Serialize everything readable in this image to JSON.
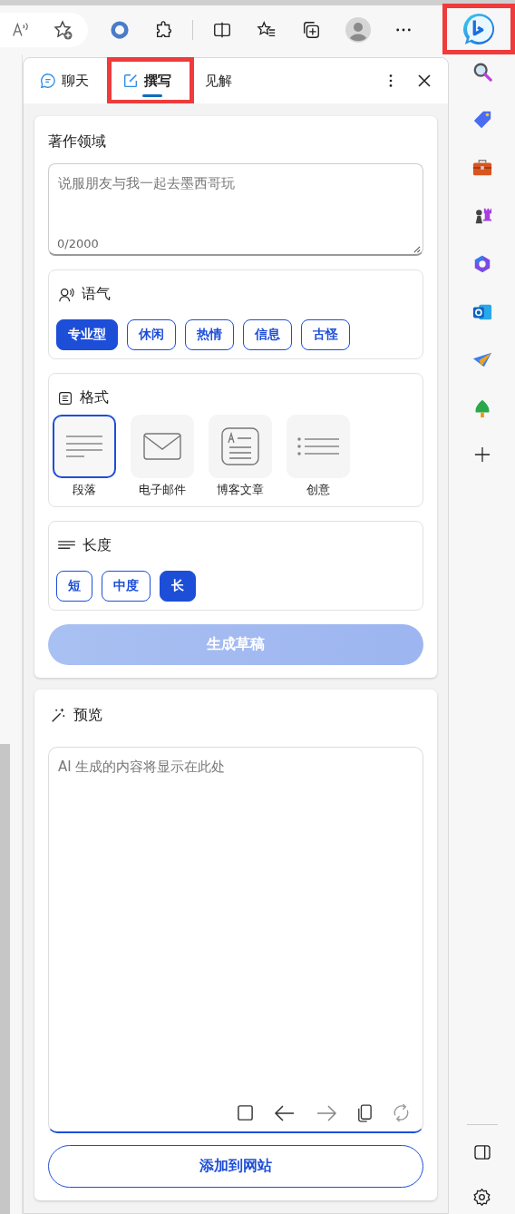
{
  "bing_button": {
    "highlighted": true
  },
  "tabs": [
    {
      "label": "聊天",
      "selected": false,
      "highlighted": false,
      "kind": "chat"
    },
    {
      "label": "撰写",
      "selected": true,
      "highlighted": true,
      "kind": "compose"
    },
    {
      "label": "见解",
      "selected": false,
      "highlighted": false,
      "kind": "insights"
    }
  ],
  "compose": {
    "title": "著作领域",
    "topic": {
      "placeholder": "说服朋友与我一起去墨西哥玩",
      "counter": "0/2000"
    },
    "tone": {
      "title": "语气",
      "options": [
        {
          "label": "专业型",
          "selected": true
        },
        {
          "label": "休闲",
          "selected": false
        },
        {
          "label": "热情",
          "selected": false
        },
        {
          "label": "信息",
          "selected": false
        },
        {
          "label": "古怪",
          "selected": false
        }
      ]
    },
    "format": {
      "title": "格式",
      "options": [
        {
          "label": "段落",
          "selected": true,
          "kind": "paragraph"
        },
        {
          "label": "电子邮件",
          "selected": false,
          "kind": "email"
        },
        {
          "label": "博客文章",
          "selected": false,
          "kind": "blog"
        },
        {
          "label": "创意",
          "selected": false,
          "kind": "ideas"
        }
      ]
    },
    "length": {
      "title": "长度",
      "options": [
        {
          "label": "短",
          "selected": false
        },
        {
          "label": "中度",
          "selected": false
        },
        {
          "label": "长",
          "selected": true
        }
      ]
    },
    "generate": {
      "label": "生成草稿",
      "disabled": true
    }
  },
  "preview": {
    "title": "预览",
    "placeholder": "AI 生成的内容将显示在此处",
    "add_button": "添加到网站"
  }
}
